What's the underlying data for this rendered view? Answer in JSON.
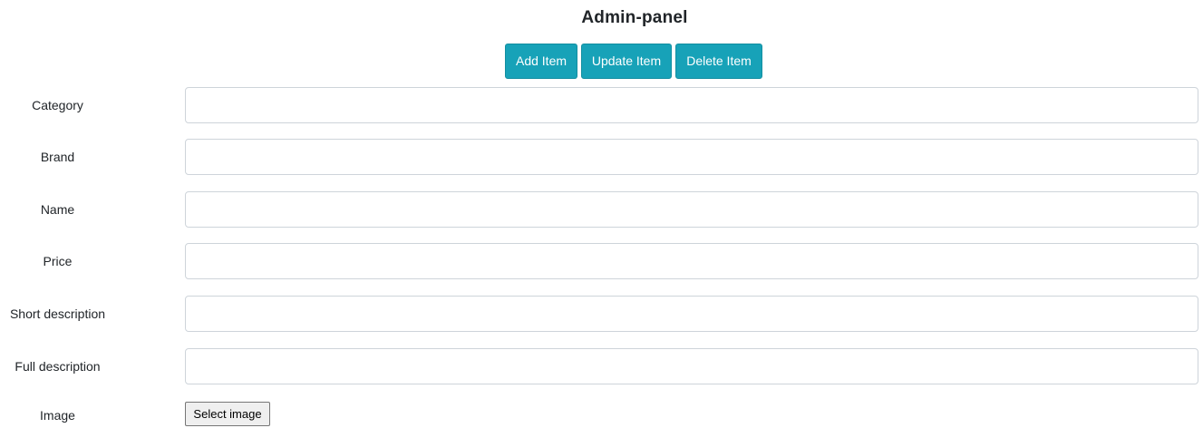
{
  "page": {
    "title": "Admin-panel"
  },
  "actions": {
    "add_label": "Add Item",
    "update_label": "Update Item",
    "delete_label": "Delete Item"
  },
  "form": {
    "fields": [
      {
        "label": "Category",
        "value": "",
        "placeholder": ""
      },
      {
        "label": "Brand",
        "value": "",
        "placeholder": ""
      },
      {
        "label": "Name",
        "value": "",
        "placeholder": ""
      },
      {
        "label": "Price",
        "value": "",
        "placeholder": ""
      },
      {
        "label": "Short description",
        "value": "",
        "placeholder": ""
      },
      {
        "label": "Full description",
        "value": "",
        "placeholder": ""
      }
    ],
    "image": {
      "label": "Image",
      "button_label": "Select image"
    }
  },
  "colors": {
    "accent": "#17a2b8",
    "input_border": "#ced4da",
    "text": "#212529"
  }
}
